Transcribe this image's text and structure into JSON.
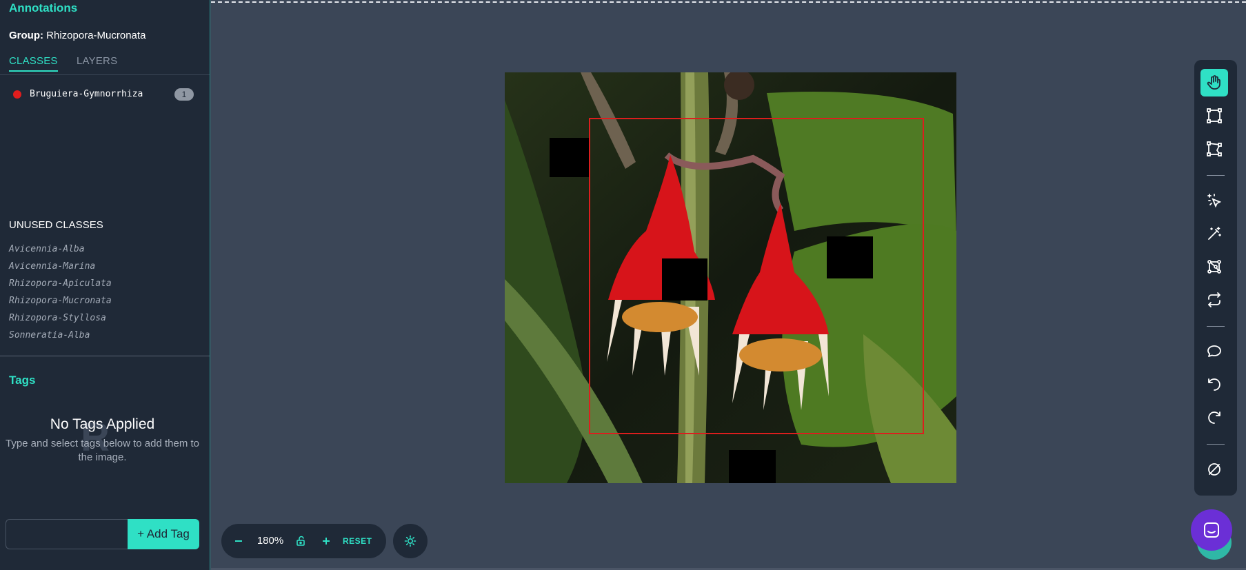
{
  "sidebar": {
    "title": "Annotations",
    "group_label": "Group:",
    "group_value": "Rhizopora-Mucronata",
    "tabs": [
      {
        "label": "CLASSES",
        "active": true
      },
      {
        "label": "LAYERS",
        "active": false
      }
    ],
    "classes": [
      {
        "name": "Bruguiera-Gymnorrhiza",
        "count": "1",
        "color": "#e11d1d"
      }
    ],
    "unused_title": "UNUSED CLASSES",
    "unused_classes": [
      "Avicennia-Alba",
      "Avicennia-Marina",
      "Rhizopora-Apiculata",
      "Rhizopora-Mucronata",
      "Rhizopora-Styllosa",
      "Sonneratia-Alba"
    ],
    "tags_title": "Tags",
    "no_tags_title": "No Tags Applied",
    "no_tags_sub": "Type and select tags below to add them to the image.",
    "tag_input_placeholder": "",
    "add_tag_label": "+ Add Tag"
  },
  "toolbar": {
    "tools": [
      "hand-icon",
      "bounding-box-icon",
      "polygon-icon",
      "smart-select-icon",
      "magic-wand-icon",
      "keypoints-icon",
      "repeat-icon",
      "comment-icon",
      "undo-icon",
      "redo-icon",
      "hide-icon"
    ],
    "active_tool": "hand-icon"
  },
  "zoom": {
    "value": "180%",
    "reset_label": "RESET"
  },
  "colors": {
    "accent": "#2fe0c5",
    "sidebar_bg": "#1f2937",
    "canvas_bg": "#3b4657",
    "bbox": "#dc1e1e",
    "chat": "#6b2fd6"
  }
}
